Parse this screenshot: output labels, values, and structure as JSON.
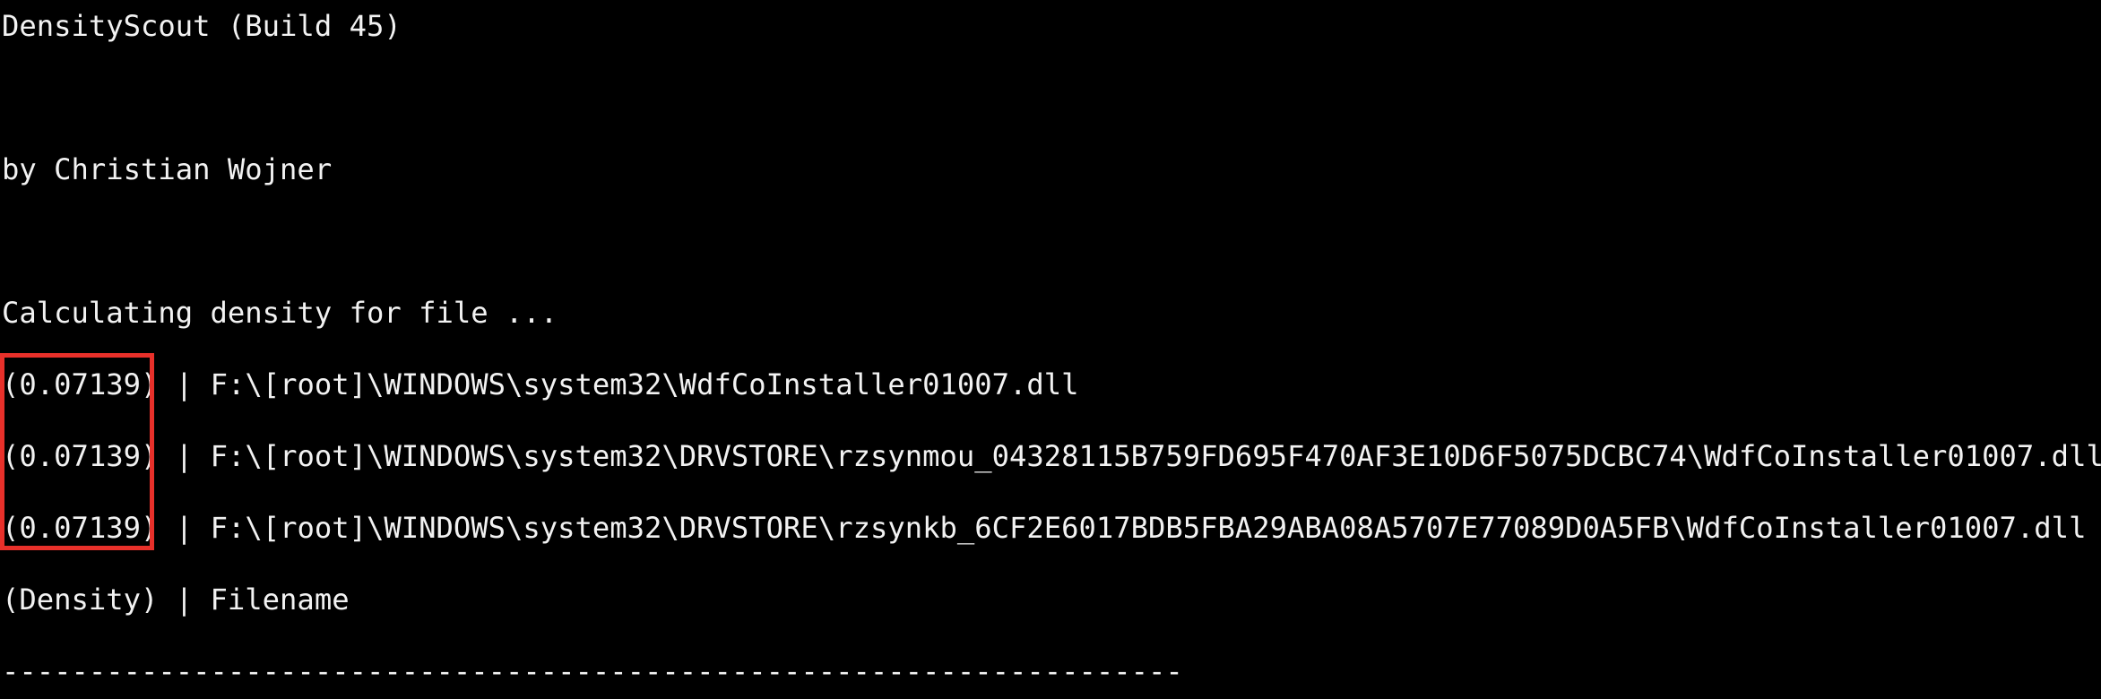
{
  "console": {
    "title_line": "DensityScout (Build 45)",
    "author_line": "by Christian Wojner",
    "status_line": "Calculating density for file ...",
    "results": [
      {
        "density": "(0.07139)",
        "separator": " | ",
        "path": "F:\\[root]\\WINDOWS\\system32\\WdfCoInstaller01007.dll"
      },
      {
        "density": "(0.07139)",
        "separator": " | ",
        "path": "F:\\[root]\\WINDOWS\\system32\\DRVSTORE\\rzsynmou_04328115B759FD695F470AF3E10D6F5075DCBC74\\WdfCoInstaller01007.dll"
      },
      {
        "density": "(0.07139)",
        "separator": " | ",
        "path": "F:\\[root]\\WINDOWS\\system32\\DRVSTORE\\rzsynkb_6CF2E6017BDB5FBA29ABA08A5707E77089D0A5FB\\WdfCoInstaller01007.dll"
      }
    ],
    "header_line": "(Density) | Filename",
    "divider_line": "--------------------------------------------------------------------"
  },
  "colors": {
    "background": "#000000",
    "text": "#f2f2f2",
    "highlight": "#e8302a"
  }
}
